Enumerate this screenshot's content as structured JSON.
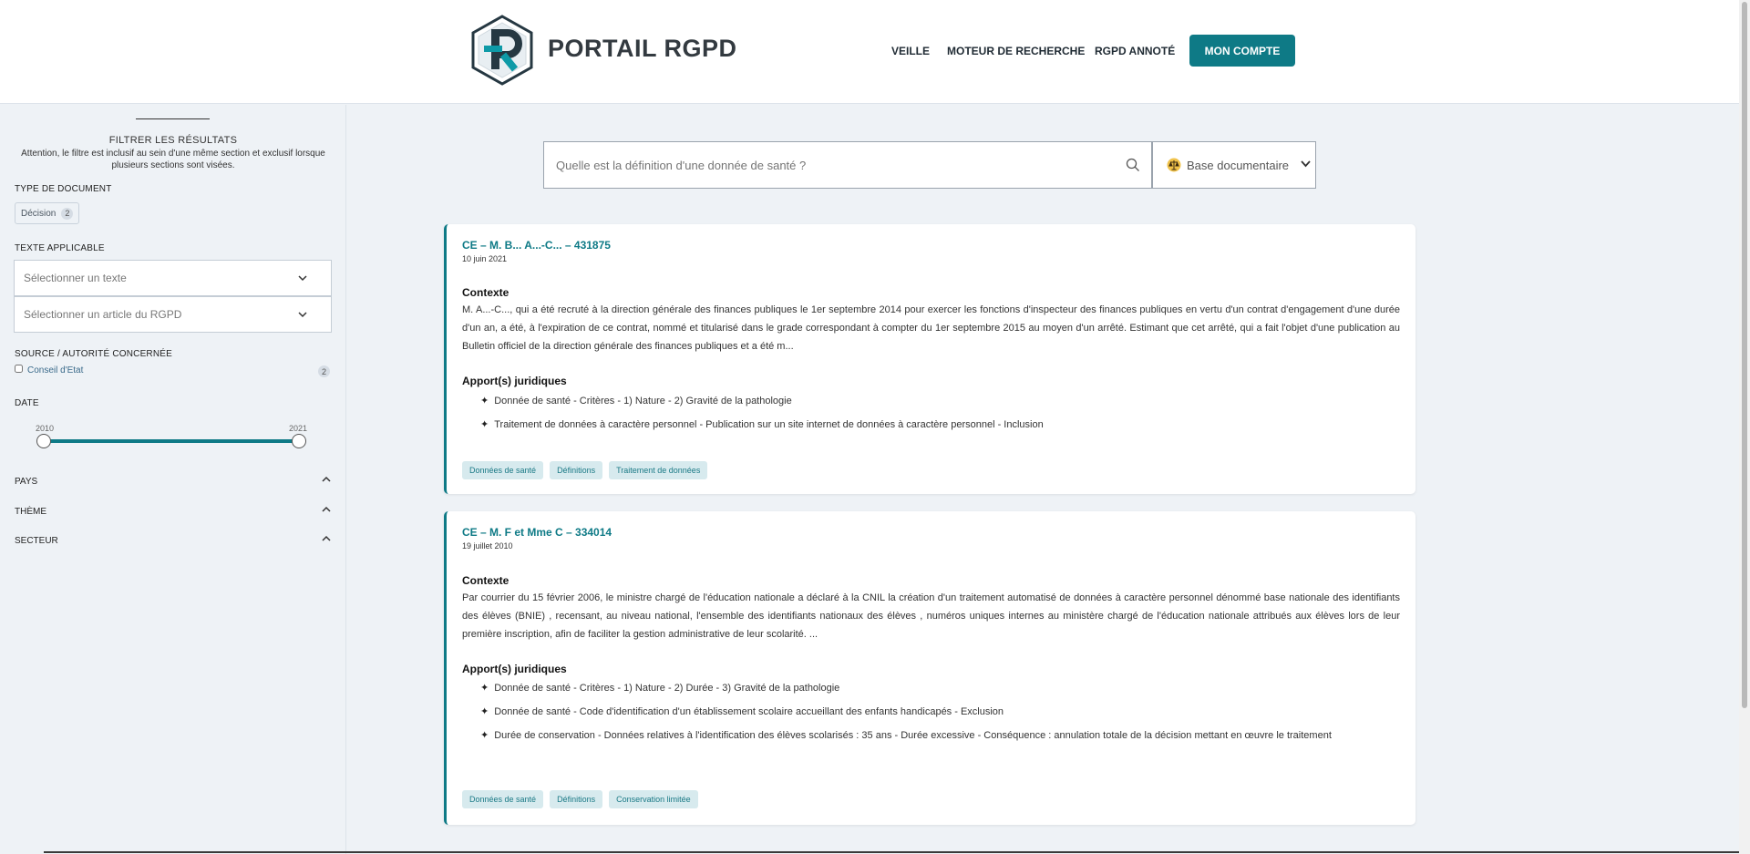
{
  "header": {
    "brand": "PORTAIL RGPD",
    "nav": [
      "VEILLE",
      "MOTEUR DE RECHERCHE",
      "RGPD ANNOTÉ"
    ],
    "account_label": "MON COMPTE"
  },
  "sidebar": {
    "title": "FILTRER LES RÉSULTATS",
    "note": "Attention, le filtre est inclusif au sein d'une même section et exclusif lorsque plusieurs sections sont visées.",
    "doc_type": {
      "label": "TYPE DE DOCUMENT",
      "chip_label": "Décision",
      "chip_count": "2"
    },
    "texte": {
      "label": "TEXTE APPLICABLE",
      "select1": "Sélectionner un texte",
      "select2": "Sélectionner un article du RGPD"
    },
    "source": {
      "label": "SOURCE / AUTORITÉ CONCERNÉE",
      "option": "Conseil d'Etat",
      "count": "2"
    },
    "date": {
      "label": "DATE",
      "min": "2010",
      "max": "2021"
    },
    "sections": [
      "PAYS",
      "THÈME",
      "SECTEUR"
    ]
  },
  "search": {
    "placeholder": "Quelle est la définition d'une donnée de santé ?",
    "base_label": "Base documentaire"
  },
  "results": [
    {
      "title": "CE – M. B... A...-C... – 431875",
      "date": "10 juin 2021",
      "context_label": "Contexte",
      "context": "M. A...-C..., qui a été recruté à la direction générale des finances publiques le 1er septembre 2014 pour exercer les fonctions d'inspecteur des finances publiques en vertu d'un contrat d'engagement d'une durée d'un an, a été, à l'expiration de ce contrat, nommé et titularisé dans le grade correspondant à compter du 1er septembre 2015 au moyen d'un arrêté. Estimant que cet arrêté, qui a fait l'objet d'une publication au Bulletin officiel de la direction générale des finances publiques et a été m...",
      "apports_label": "Apport(s) juridiques",
      "apports": [
        "Donnée de santé - Critères - 1) Nature - 2) Gravité de la pathologie",
        "Traitement de données à caractère personnel - Publication sur un site internet de données à caractère personnel - Inclusion"
      ],
      "tags": [
        "Données de santé",
        "Définitions",
        "Traitement de données"
      ]
    },
    {
      "title": "CE – M. F et Mme C – 334014",
      "date": "19 juillet 2010",
      "context_label": "Contexte",
      "context": "Par courrier du 15 février 2006, le ministre chargé de l'éducation nationale a déclaré à la CNIL la création d'un traitement automatisé de données à caractère personnel dénommé base nationale des identifiants des élèves (BNIE) , recensant, au niveau national, l'ensemble des identifiants nationaux des élèves , numéros uniques internes au ministère chargé de l'éducation nationale attribués aux élèves lors de leur première inscription, afin de faciliter la gestion administrative de leur scolarité. ...",
      "apports_label": "Apport(s) juridiques",
      "apports": [
        "Donnée de santé - Critères - 1) Nature - 2) Durée - 3) Gravité de la pathologie",
        "Donnée de santé - Code d'identification d'un établissement scolaire accueillant des enfants handicapés - Exclusion",
        "Durée de conservation - Données relatives à l'identification des élèves scolarisés : 35 ans - Durée excessive - Conséquence : annulation totale de la décision mettant en œuvre le traitement"
      ],
      "tags": [
        "Données de santé",
        "Définitions",
        "Conservation limitée"
      ]
    }
  ],
  "colors": {
    "accent": "#0e7a86",
    "background": "#eef2f6",
    "tag_bg": "#d7eaee"
  }
}
